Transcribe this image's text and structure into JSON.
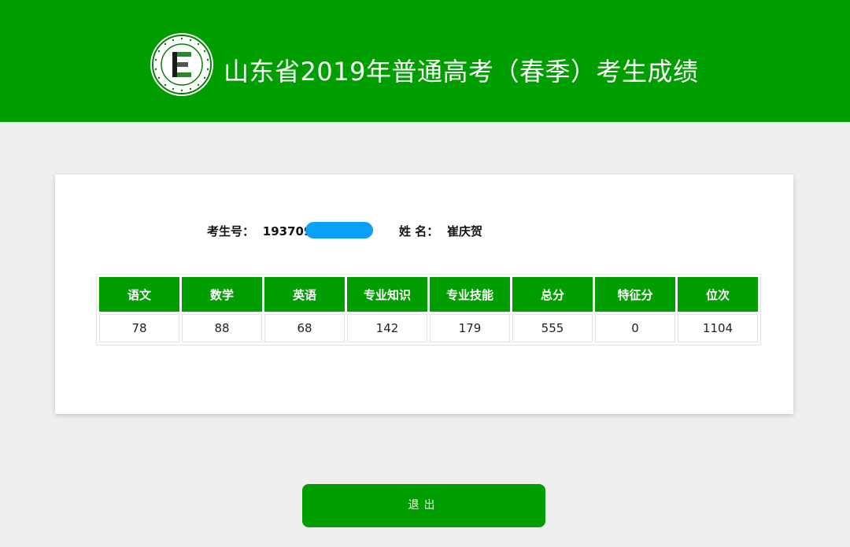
{
  "header": {
    "title": "山东省2019年普通高考（春季）考生成绩",
    "logo_letter": "E",
    "logo_ring_text": "Shandong Education Admission & Examination",
    "logo_cn_text": "山东省教育招生考试院"
  },
  "student": {
    "id_label": "考生号：",
    "id_value": "193709",
    "name_label": "姓 名：",
    "name_value": "崔庆贺"
  },
  "scores": {
    "headers": [
      "语文",
      "数学",
      "英语",
      "专业知识",
      "专业技能",
      "总分",
      "特征分",
      "位次"
    ],
    "values": [
      "78",
      "88",
      "68",
      "142",
      "179",
      "555",
      "0",
      "1104"
    ]
  },
  "actions": {
    "exit_label": "退出"
  },
  "colors": {
    "brand_green": "#009e00",
    "redaction_blue": "#0aa0f5",
    "page_bg": "#efefef"
  }
}
